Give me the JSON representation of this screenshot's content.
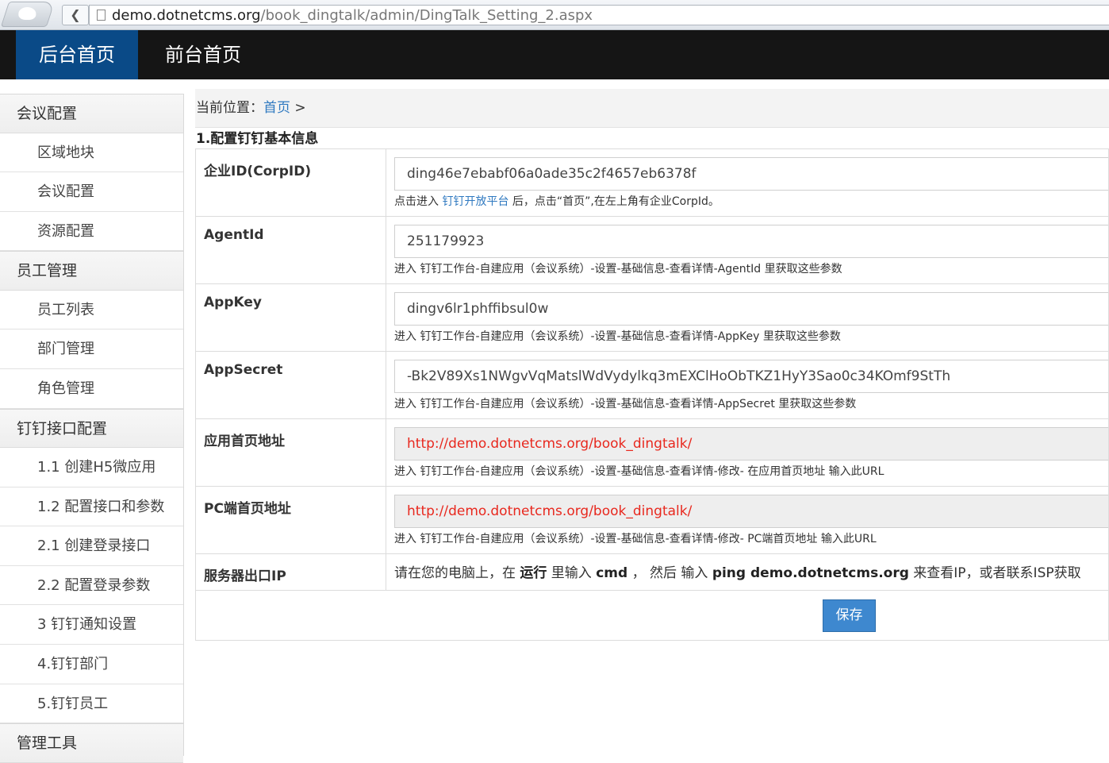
{
  "browser": {
    "url_host": "demo.dotnetcms.org",
    "url_path": "/book_dingtalk/admin/DingTalk_Setting_2.aspx",
    "back_glyph": "❮"
  },
  "topnav": {
    "items": [
      {
        "label": "后台首页"
      },
      {
        "label": "前台首页"
      }
    ]
  },
  "sidebar": {
    "groups": [
      {
        "label": "会议配置",
        "items": [
          "区域地块",
          "会议配置",
          "资源配置"
        ]
      },
      {
        "label": "员工管理",
        "items": [
          "员工列表",
          "部门管理",
          "角色管理"
        ]
      },
      {
        "label": "钉钉接口配置",
        "items": [
          "1.1 创建H5微应用",
          "1.2 配置接口和参数",
          "2.1 创建登录接口",
          "2.2 配置登录参数",
          "3 钉钉通知设置",
          "4.钉钉部门",
          "5.钉钉员工"
        ]
      },
      {
        "label": "管理工具",
        "items": []
      }
    ]
  },
  "breadcrumb": {
    "prefix": "当前位置：",
    "home": "首页",
    "sep": " >"
  },
  "form": {
    "section_title": "1.配置钉钉基本信息",
    "rows": [
      {
        "label": "企业ID(CorpID)",
        "value": "ding46e7ebabf06a0ade35c2f4657eb6378f",
        "hint_before": "点击进入 ",
        "hint_link": "钉钉开放平台",
        "hint_after": " 后，点击“首页”,在左上角有企业CorpId。"
      },
      {
        "label": "AgentId",
        "value": "251179923",
        "hint": "进入 钉钉工作台-自建应用（会议系统）-设置-基础信息-查看详情-AgentId 里获取这些参数"
      },
      {
        "label": "AppKey",
        "value": "dingv6lr1phffibsul0w",
        "hint": "进入 钉钉工作台-自建应用（会议系统）-设置-基础信息-查看详情-AppKey 里获取这些参数"
      },
      {
        "label": "AppSecret",
        "value": "-Bk2V89Xs1NWgvVqMatslWdVydylkq3mEXClHoObTKZ1HyY3Sao0c34KOmf9StTh",
        "hint": "进入 钉钉工作台-自建应用（会议系统）-设置-基础信息-查看详情-AppSecret 里获取这些参数"
      },
      {
        "label": "应用首页地址",
        "value": "http://demo.dotnetcms.org/book_dingtalk/",
        "hint": "进入 钉钉工作台-自建应用（会议系统）-设置-基础信息-查看详情-修改- 在应用首页地址 输入此URL"
      },
      {
        "label": "PC端首页地址",
        "value": "http://demo.dotnetcms.org/book_dingtalk/",
        "hint": "进入 钉钉工作台-自建应用（会议系统）-设置-基础信息-查看详情-修改- PC端首页地址 输入此URL"
      }
    ],
    "ip": {
      "label": "服务器出口IP",
      "t1": "请在您的电脑上，在 ",
      "b1": "运行",
      "t2": " 里输入 ",
      "b2": "cmd",
      "t3": " ， 然后 输入 ",
      "b3": "ping demo.dotnetcms.org",
      "t4": " 来查看IP，或者联系ISP获取"
    },
    "save_label": "保存"
  }
}
